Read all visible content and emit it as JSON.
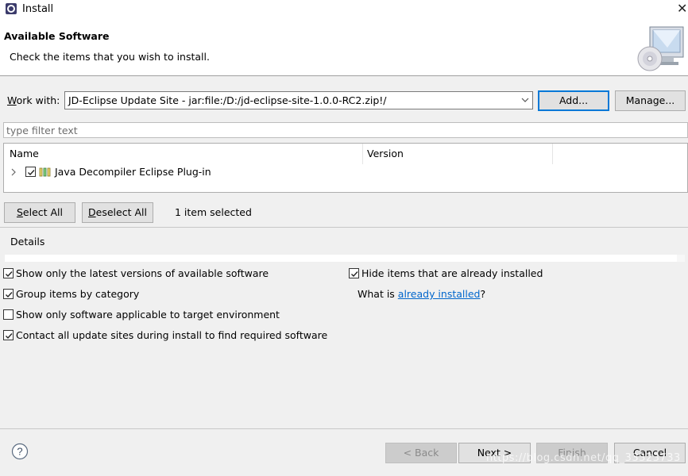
{
  "window": {
    "title": "Install",
    "close_glyph": "✕"
  },
  "banner": {
    "title": "Available Software",
    "subtitle": "Check the items that you wish to install."
  },
  "work_with": {
    "label_prefix": "W",
    "label_rest": "ork with:",
    "value": "JD-Eclipse Update Site - jar:file:/D:/jd-eclipse-site-1.0.0-RC2.zip!/",
    "add_button": "Add...",
    "manage_button": "Manage..."
  },
  "filter": {
    "placeholder": "type filter text"
  },
  "tree": {
    "columns": [
      "Name",
      "Version"
    ],
    "rows": [
      {
        "name": "Java Decompiler Eclipse Plug-in",
        "version": "",
        "checked": true,
        "icon": "plugin-category-icon"
      }
    ]
  },
  "selection": {
    "select_all": "Select All",
    "deselect_all": "Deselect All",
    "status": "1 item selected"
  },
  "details": {
    "label": "Details"
  },
  "options": {
    "show_latest": {
      "label": "Show only the latest versions of available software",
      "checked": true
    },
    "group_by_category": {
      "label": "Group items by category",
      "checked": true
    },
    "target_env": {
      "label": "Show only software applicable to target environment",
      "checked": false
    },
    "contact_sites": {
      "label": "Contact all update sites during install to find required software",
      "checked": true
    },
    "hide_installed": {
      "label": "Hide items that are already installed",
      "checked": true
    },
    "what_is_prefix": "What is ",
    "what_is_link": "already installed",
    "what_is_suffix": "?"
  },
  "footer": {
    "back": "< Back",
    "next": "Next >",
    "finish": "Finish",
    "cancel": "Cancel",
    "watermark": "https://blog.csdn.net/qq_33323733"
  },
  "colors": {
    "accent": "#0078d7",
    "link": "#0066cc",
    "dialog_bg": "#f0f0f0"
  }
}
